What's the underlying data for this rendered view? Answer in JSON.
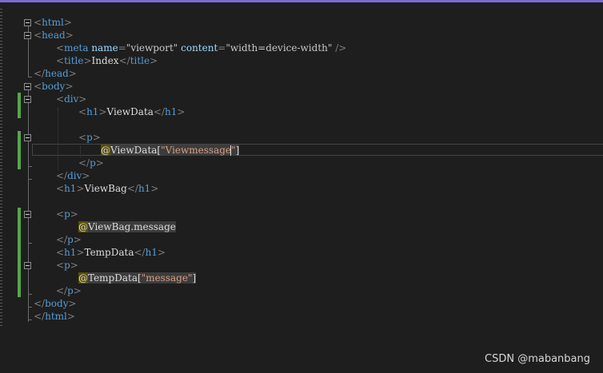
{
  "editor": {
    "lines": {
      "l1": {
        "open": "<",
        "tag": "html",
        "close": ">"
      },
      "l2": {
        "open": "<",
        "tag": "head",
        "close": ">"
      },
      "l3": {
        "open": "<",
        "tag": "meta",
        "sp1": " ",
        "attr1": "name",
        "eq1": "=",
        "val1": "\"viewport\"",
        "sp2": " ",
        "attr2": "content",
        "eq2": "=",
        "val2": "\"width=device-width\"",
        "end": " />"
      },
      "l4": {
        "open": "<",
        "tag": "title",
        "close": ">",
        "text": "Index",
        "open2": "</",
        "tag2": "title",
        "close2": ">"
      },
      "l5": {
        "open": "</",
        "tag": "head",
        "close": ">"
      },
      "l6": {
        "open": "<",
        "tag": "body",
        "close": ">"
      },
      "l7": {
        "open": "<",
        "tag": "div",
        "close": ">"
      },
      "l8": {
        "open": "<",
        "tag": "h1",
        "close": ">",
        "text": "ViewData",
        "open2": "</",
        "tag2": "h1",
        "close2": ">"
      },
      "l10": {
        "open": "<",
        "tag": "p",
        "close": ">"
      },
      "l11": {
        "at": "@",
        "ident": "ViewData[",
        "str1": "\"Viewmessage",
        "str2": "\"",
        "end": "]"
      },
      "l12": {
        "open": "</",
        "tag": "p",
        "close": ">"
      },
      "l13": {
        "open": "</",
        "tag": "div",
        "close": ">"
      },
      "l14": {
        "open": "<",
        "tag": "h1",
        "close": ">",
        "text": "ViewBag",
        "open2": "</",
        "tag2": "h1",
        "close2": ">"
      },
      "l16": {
        "open": "<",
        "tag": "p",
        "close": ">"
      },
      "l17": {
        "at": "@",
        "ident": "ViewBag.message"
      },
      "l18": {
        "open": "</",
        "tag": "p",
        "close": ">"
      },
      "l19": {
        "open": "<",
        "tag": "h1",
        "close": ">",
        "text": "TempData",
        "open2": "</",
        "tag2": "h1",
        "close2": ">"
      },
      "l20": {
        "open": "<",
        "tag": "p",
        "close": ">"
      },
      "l21": {
        "at": "@",
        "ident": "TempData[",
        "str": "\"message\"",
        "end": "]"
      },
      "l22": {
        "open": "</",
        "tag": "p",
        "close": ">"
      },
      "l23": {
        "open": "</",
        "tag": "body",
        "close": ">"
      },
      "l24": {
        "open": "</",
        "tag": "html",
        "close": ">"
      }
    }
  },
  "watermark": "CSDN @mabanbang",
  "colors": {
    "background": "#1e1e1e",
    "tag": "#569cd6",
    "attribute": "#9cdcfe",
    "punctuation": "#808080",
    "razor_string": "#d69d85",
    "change_bar": "#57a64a",
    "top_accent": "#7c6ad6"
  }
}
